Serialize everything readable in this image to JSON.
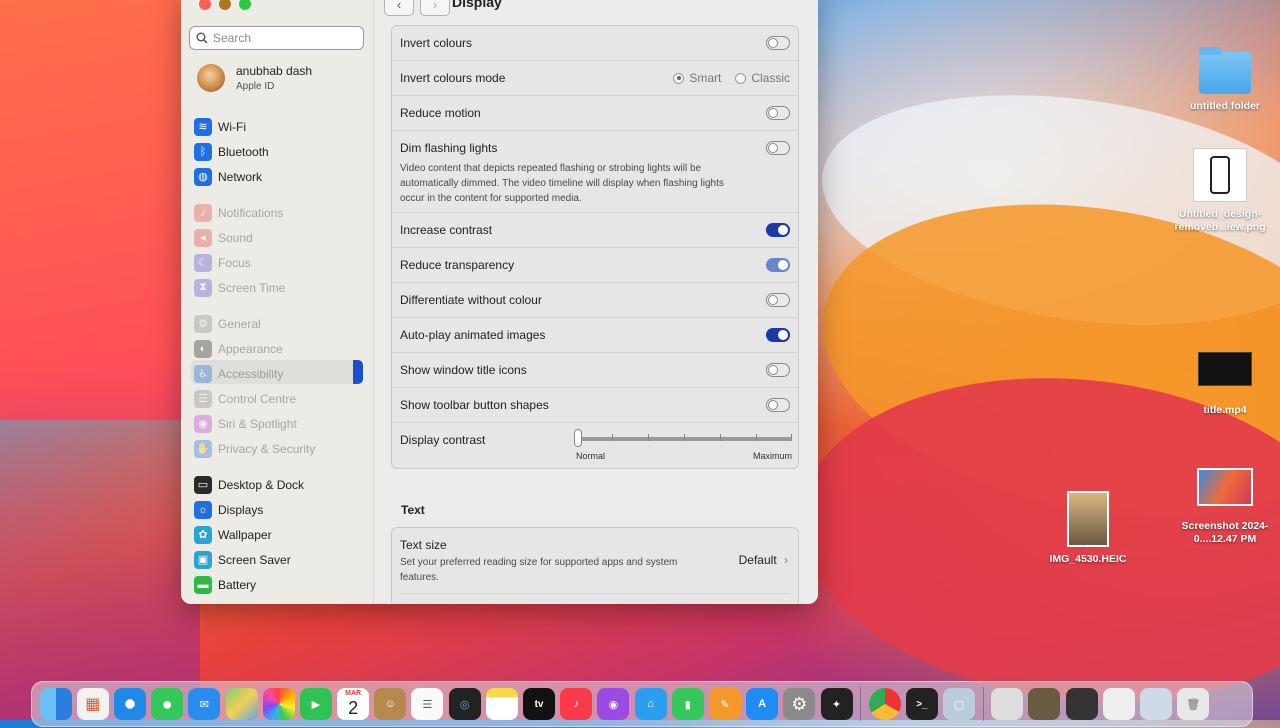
{
  "window": {
    "title": "Display"
  },
  "sidebar": {
    "search_placeholder": "Search",
    "profile": {
      "name": "anubhab dash",
      "sub": "Apple ID"
    },
    "groups": [
      [
        {
          "label": "Wi-Fi",
          "icon": "wifi-icon",
          "color": "#1f6fe0",
          "glyph": "≋"
        },
        {
          "label": "Bluetooth",
          "icon": "bluetooth-icon",
          "color": "#1f6fe0",
          "glyph": "ᛒ"
        },
        {
          "label": "Network",
          "icon": "globe-icon",
          "color": "#1f6fe0",
          "glyph": "◍"
        }
      ],
      [
        {
          "label": "Notifications",
          "icon": "bell-icon",
          "color": "#e8453c",
          "glyph": "♪"
        },
        {
          "label": "Sound",
          "icon": "speaker-icon",
          "color": "#e8453c",
          "glyph": "◂"
        },
        {
          "label": "Focus",
          "icon": "moon-icon",
          "color": "#5b4bd6",
          "glyph": "☾"
        },
        {
          "label": "Screen Time",
          "icon": "hourglass-icon",
          "color": "#5b4bd6",
          "glyph": "⧗"
        }
      ],
      [
        {
          "label": "General",
          "icon": "gear-icon",
          "color": "#8a8a8a",
          "glyph": "⚙"
        },
        {
          "label": "Appearance",
          "icon": "appearance-icon",
          "color": "#222",
          "glyph": "◐"
        },
        {
          "label": "Accessibility",
          "icon": "accessibility-icon",
          "color": "#1f6fe0",
          "glyph": "♿"
        },
        {
          "label": "Control Centre",
          "icon": "control-centre-icon",
          "color": "#8a8a8a",
          "glyph": "☰"
        },
        {
          "label": "Siri & Spotlight",
          "icon": "siri-icon",
          "color": "#c03ad6",
          "glyph": "◉"
        },
        {
          "label": "Privacy & Security",
          "icon": "hand-icon",
          "color": "#1f6fe0",
          "glyph": "✋"
        }
      ],
      [
        {
          "label": "Desktop & Dock",
          "icon": "dock-icon",
          "color": "#2a2a2a",
          "glyph": "▭"
        },
        {
          "label": "Displays",
          "icon": "display-icon",
          "color": "#1f6fe0",
          "glyph": "☼"
        },
        {
          "label": "Wallpaper",
          "icon": "wallpaper-icon",
          "color": "#2aa4d6",
          "glyph": "✿"
        },
        {
          "label": "Screen Saver",
          "icon": "screensaver-icon",
          "color": "#2aa4d6",
          "glyph": "▣"
        },
        {
          "label": "Battery",
          "icon": "battery-icon",
          "color": "#2fb84a",
          "glyph": "▬"
        }
      ]
    ]
  },
  "display": {
    "invert_colours": "Invert colours",
    "invert_mode": "Invert colours mode",
    "mode_smart": "Smart",
    "mode_classic": "Classic",
    "reduce_motion": "Reduce motion",
    "dim_flashing": "Dim flashing lights",
    "dim_flashing_desc": "Video content that depicts repeated flashing or strobing lights will be automatically dimmed. The video timeline will display when flashing lights occur in the content for supported media.",
    "increase_contrast": "Increase contrast",
    "reduce_transparency": "Reduce transparency",
    "differentiate": "Differentiate without colour",
    "autoplay": "Auto-play animated images",
    "title_icons": "Show window title icons",
    "toolbar_shapes": "Show toolbar button shapes",
    "display_contrast": "Display contrast",
    "contrast_min": "Normal",
    "contrast_max": "Maximum",
    "contrast_level": 0
  },
  "text_section": {
    "heading": "Text",
    "text_size": "Text size",
    "text_size_desc": "Set your preferred reading size for supported apps and system features.",
    "text_size_value": "Default"
  },
  "desktop_icons": [
    {
      "label": "untitled folder"
    },
    {
      "label": "Untitled_design-removeb...iew.png"
    },
    {
      "label": "title.mp4"
    },
    {
      "label": "IMG_4530.HEIC"
    },
    {
      "label": "Screenshot 2024-0....12.47 PM"
    }
  ],
  "dock": {
    "calendar_month": "MAR",
    "calendar_day": "2",
    "tv_label": "tv"
  }
}
